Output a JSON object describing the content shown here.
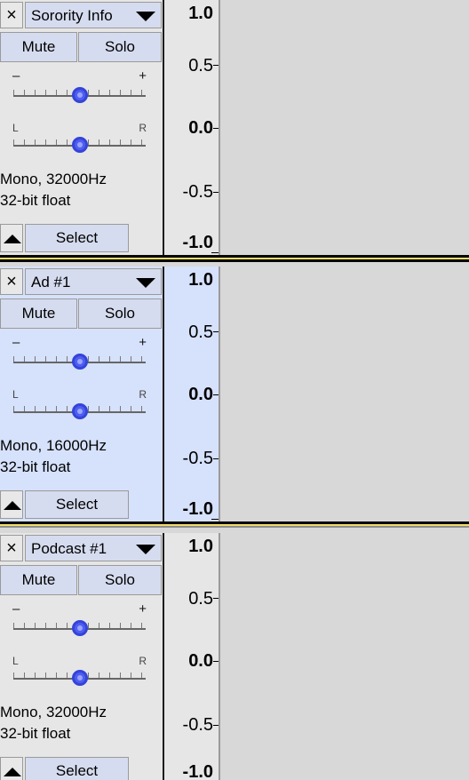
{
  "colors": {
    "panel": "#e6e6e6",
    "panel_selected": "#d6e1fb",
    "button": "#d6dcef",
    "slider_thumb": "#4f5ef0",
    "separator_focus": "#f0dd6a",
    "separator_dark": "#050505",
    "waveform_background": "#d8d8d8"
  },
  "icons": {
    "close": "close-icon",
    "dropdown": "chevron-down-icon",
    "collapse": "collapse-up-icon"
  },
  "tracks": [
    {
      "name": "Sorority Info",
      "close_glyph": "×",
      "mute_label": "Mute",
      "solo_label": "Solo",
      "gain": {
        "minus": "–",
        "plus": "+",
        "value": 0.5
      },
      "pan": {
        "left": "L",
        "right": "R",
        "value": 0.5
      },
      "rate": "Mono, 32000Hz",
      "format": "32-bit float",
      "select_label": "Select",
      "selected": false,
      "ruler": {
        "top": "1.0",
        "upper": "0.5",
        "middle": "0.0",
        "lower": "-0.5",
        "bottom": "-1.0"
      }
    },
    {
      "name": "Ad #1",
      "close_glyph": "×",
      "mute_label": "Mute",
      "solo_label": "Solo",
      "gain": {
        "minus": "–",
        "plus": "+",
        "value": 0.5
      },
      "pan": {
        "left": "L",
        "right": "R",
        "value": 0.5
      },
      "rate": "Mono, 16000Hz",
      "format": "32-bit float",
      "select_label": "Select",
      "selected": true,
      "ruler": {
        "top": "1.0",
        "upper": "0.5",
        "middle": "0.0",
        "lower": "-0.5",
        "bottom": "-1.0"
      }
    },
    {
      "name": "Podcast #1",
      "close_glyph": "×",
      "mute_label": "Mute",
      "solo_label": "Solo",
      "gain": {
        "minus": "–",
        "plus": "+",
        "value": 0.5
      },
      "pan": {
        "left": "L",
        "right": "R",
        "value": 0.5
      },
      "rate": "Mono, 32000Hz",
      "format": "32-bit float",
      "select_label": "Select",
      "selected": false,
      "ruler": {
        "top": "1.0",
        "upper": "0.5",
        "middle": "0.0",
        "lower": "-0.5",
        "bottom": "-1.0"
      }
    }
  ]
}
